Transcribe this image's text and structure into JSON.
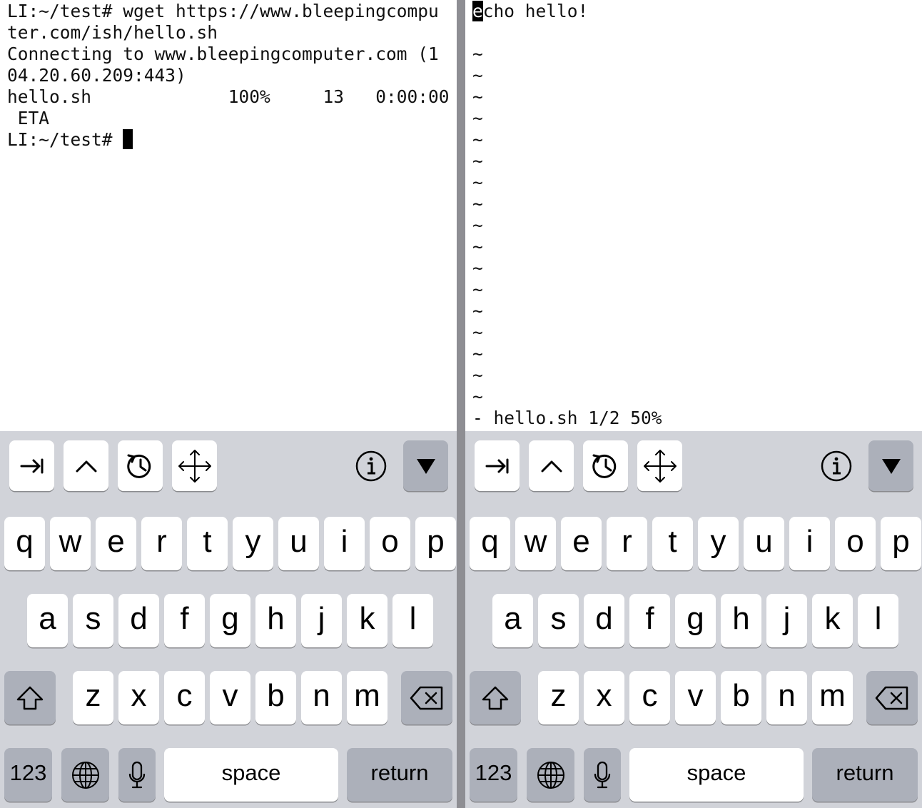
{
  "left_terminal": {
    "lines": [
      "LI:~/test# wget https://www.bleepingcompu",
      "ter.com/ish/hello.sh",
      "Connecting to www.bleepingcomputer.com (1",
      "04.20.60.209:443)",
      "hello.sh             100%     13   0:00:00",
      " ETA"
    ],
    "prompt": "LI:~/test# "
  },
  "right_editor": {
    "cursor_char": "e",
    "first_line_rest": "cho hello!",
    "tilde": "~",
    "status": "- hello.sh 1/2 50%"
  },
  "accessory_icons": [
    "tab-icon",
    "control-caret-icon",
    "history-icon",
    "arrows-move-icon",
    "info-icon",
    "hide-keyboard-icon"
  ],
  "keyboard": {
    "row1": [
      "q",
      "w",
      "e",
      "r",
      "t",
      "y",
      "u",
      "i",
      "o",
      "p"
    ],
    "row2": [
      "a",
      "s",
      "d",
      "f",
      "g",
      "h",
      "j",
      "k",
      "l"
    ],
    "row3": [
      "z",
      "x",
      "c",
      "v",
      "b",
      "n",
      "m"
    ],
    "numbers_label": "123",
    "space_label": "space",
    "return_label": "return"
  },
  "colors": {
    "keyboard_bg": "#d1d3d9",
    "key_bg": "#ffffff",
    "func_key_bg": "#acb0ba",
    "divider": "#8e8e93"
  }
}
